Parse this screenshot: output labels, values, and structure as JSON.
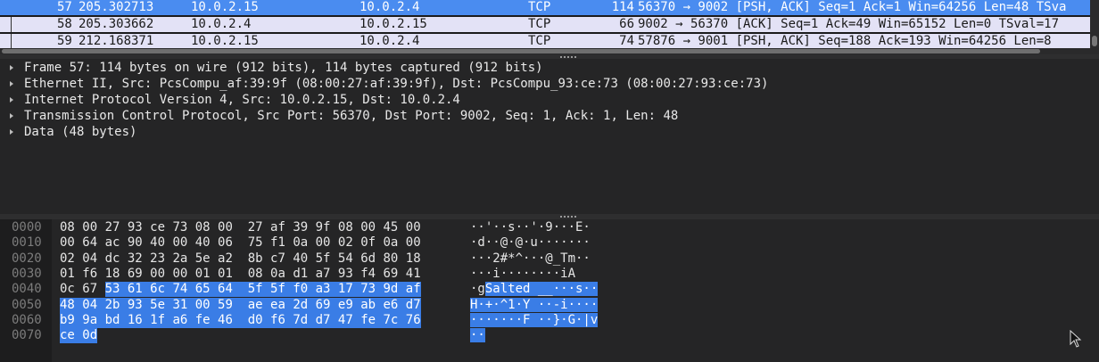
{
  "packets": [
    {
      "no": "57",
      "time": "205.302713",
      "src": "10.0.2.15",
      "dst": "10.0.2.4",
      "proto": "TCP",
      "len": "114",
      "info": "56370 → 9002 [PSH, ACK] Seq=1 Ack=1 Win=64256 Len=48 TSva",
      "selected": true
    },
    {
      "no": "58",
      "time": "205.303662",
      "src": "10.0.2.4",
      "dst": "10.0.2.15",
      "proto": "TCP",
      "len": "66",
      "info": "9002 → 56370 [ACK] Seq=1 Ack=49 Win=65152 Len=0 TSval=17",
      "selected": false
    },
    {
      "no": "59",
      "time": "212.168371",
      "src": "10.0.2.15",
      "dst": "10.0.2.4",
      "proto": "TCP",
      "len": "74",
      "info": "57876 → 9001 [PSH, ACK] Seq=188 Ack=193 Win=64256 Len=8",
      "selected": false
    }
  ],
  "detail": [
    {
      "text": "Frame 57: 114 bytes on wire (912 bits), 114 bytes captured (912 bits)",
      "icon": "triangle-right-icon"
    },
    {
      "text": "Ethernet II, Src: PcsCompu_af:39:9f (08:00:27:af:39:9f), Dst: PcsCompu_93:ce:73 (08:00:27:93:ce:73)",
      "icon": "triangle-right-icon"
    },
    {
      "text": "Internet Protocol Version 4, Src: 10.0.2.15, Dst: 10.0.2.4",
      "icon": "triangle-right-icon"
    },
    {
      "text": "Transmission Control Protocol, Src Port: 56370, Dst Port: 9002, Seq: 1, Ack: 1, Len: 48",
      "icon": "triangle-right-icon"
    },
    {
      "text": "Data (48 bytes)",
      "icon": "triangle-right-icon"
    }
  ],
  "bytes": [
    {
      "offset": "0000",
      "hex": [
        "08",
        "00",
        "27",
        "93",
        "ce",
        "73",
        "08",
        "00",
        "27",
        "af",
        "39",
        "9f",
        "08",
        "00",
        "45",
        "00"
      ],
      "ascii": "··'··s··'·9···E·",
      "sel_from": 16
    },
    {
      "offset": "0010",
      "hex": [
        "00",
        "64",
        "ac",
        "90",
        "40",
        "00",
        "40",
        "06",
        "75",
        "f1",
        "0a",
        "00",
        "02",
        "0f",
        "0a",
        "00"
      ],
      "ascii": "·d··@·@·u·······",
      "sel_from": 16
    },
    {
      "offset": "0020",
      "hex": [
        "02",
        "04",
        "dc",
        "32",
        "23",
        "2a",
        "5e",
        "a2",
        "8b",
        "c7",
        "40",
        "5f",
        "54",
        "6d",
        "80",
        "18"
      ],
      "ascii": "···2#*^···@_Tm··",
      "sel_from": 16
    },
    {
      "offset": "0030",
      "hex": [
        "01",
        "f6",
        "18",
        "69",
        "00",
        "00",
        "01",
        "01",
        "08",
        "0a",
        "d1",
        "a7",
        "93",
        "f4",
        "69",
        "41"
      ],
      "ascii": "···i········iA",
      "sel_from": 16
    },
    {
      "offset": "0040",
      "hex": [
        "0c",
        "67",
        "53",
        "61",
        "6c",
        "74",
        "65",
        "64",
        "5f",
        "5f",
        "f0",
        "a3",
        "17",
        "73",
        "9d",
        "af"
      ],
      "ascii": "·gSalted __···s··",
      "sel_from": 2
    },
    {
      "offset": "0050",
      "hex": [
        "48",
        "04",
        "2b",
        "93",
        "5e",
        "31",
        "00",
        "59",
        "ae",
        "ea",
        "2d",
        "69",
        "e9",
        "ab",
        "e6",
        "d7"
      ],
      "ascii": "H·+·^1·Y ··-i····",
      "sel_from": 0
    },
    {
      "offset": "0060",
      "hex": [
        "b9",
        "9a",
        "bd",
        "16",
        "1f",
        "a6",
        "fe",
        "46",
        "d0",
        "f6",
        "7d",
        "d7",
        "47",
        "fe",
        "7c",
        "76"
      ],
      "ascii": "·······F ··}·G·|v",
      "sel_from": 0
    },
    {
      "offset": "0070",
      "hex": [
        "ce",
        "0d"
      ],
      "ascii": "··",
      "sel_from": 0
    }
  ],
  "colors": {
    "selection": "#3a7de6",
    "row_selected": "#4a8cf0",
    "row_normal": "#e3e2f6"
  }
}
